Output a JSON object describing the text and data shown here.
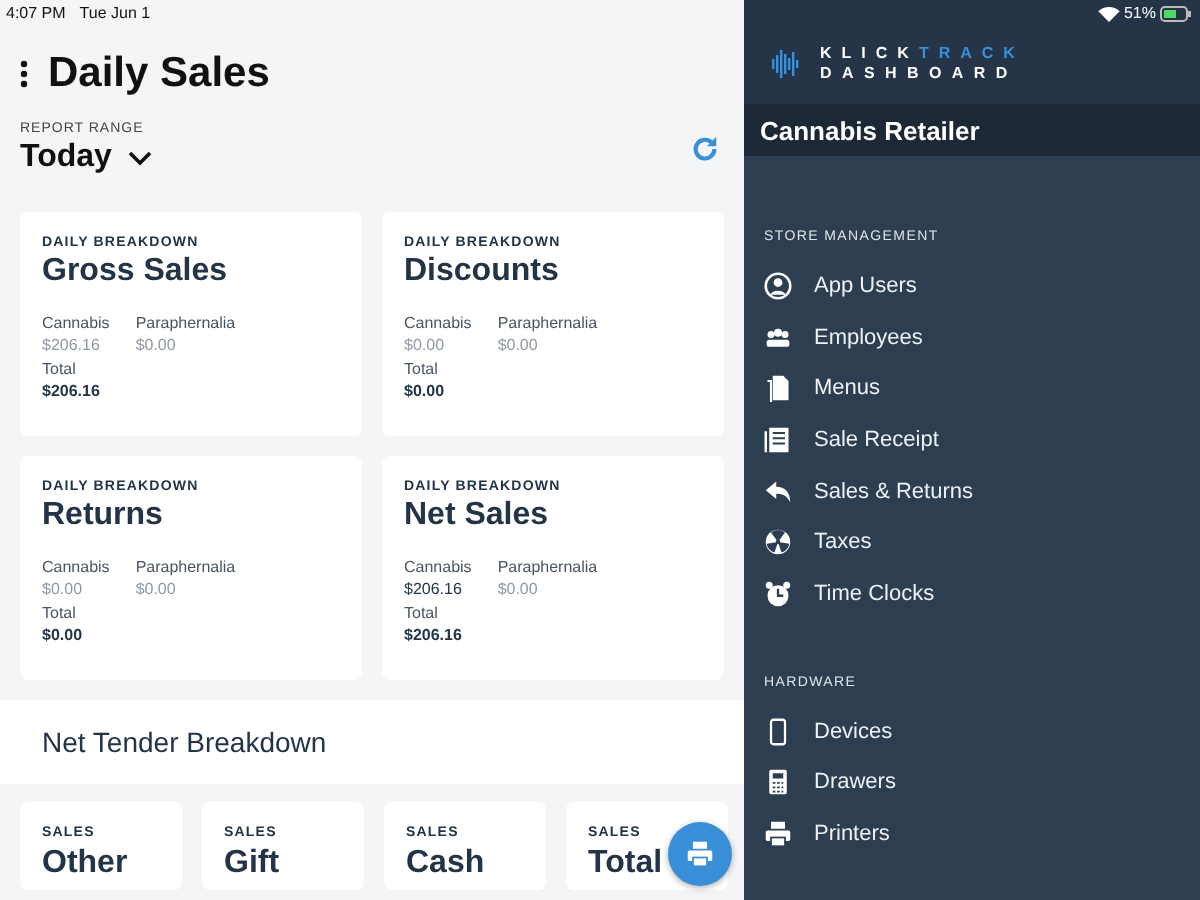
{
  "status_bar": {
    "time": "4:07 PM",
    "date": "Tue Jun 1",
    "battery_text": "51%"
  },
  "header": {
    "title": "Daily Sales",
    "report_range_label": "REPORT RANGE",
    "report_range_value": "Today"
  },
  "breakdown_cards": [
    {
      "overline": "DAILY BREAKDOWN",
      "title": "Gross Sales",
      "values": [
        {
          "label": "Cannabis",
          "amount": "$206.16",
          "dimmed": true
        },
        {
          "label": "Paraphernalia",
          "amount": "$0.00",
          "dimmed": true
        }
      ],
      "total_label": "Total",
      "total": "$206.16"
    },
    {
      "overline": "DAILY BREAKDOWN",
      "title": "Discounts",
      "values": [
        {
          "label": "Cannabis",
          "amount": "$0.00",
          "dimmed": true
        },
        {
          "label": "Paraphernalia",
          "amount": "$0.00",
          "dimmed": true
        }
      ],
      "total_label": "Total",
      "total": "$0.00"
    },
    {
      "overline": "DAILY BREAKDOWN",
      "title": "Returns",
      "values": [
        {
          "label": "Cannabis",
          "amount": "$0.00",
          "dimmed": true
        },
        {
          "label": "Paraphernalia",
          "amount": "$0.00",
          "dimmed": true
        }
      ],
      "total_label": "Total",
      "total": "$0.00"
    },
    {
      "overline": "DAILY BREAKDOWN",
      "title": "Net Sales",
      "values": [
        {
          "label": "Cannabis",
          "amount": "$206.16",
          "dimmed": false
        },
        {
          "label": "Paraphernalia",
          "amount": "$0.00",
          "dimmed": true
        }
      ],
      "total_label": "Total",
      "total": "$206.16"
    }
  ],
  "tender_section": {
    "title": "Net Tender Breakdown"
  },
  "tender_cards": [
    {
      "overline": "SALES",
      "title": "Other"
    },
    {
      "overline": "SALES",
      "title": "Gift"
    },
    {
      "overline": "SALES",
      "title": "Cash"
    },
    {
      "overline": "SALES",
      "title": "Total"
    }
  ],
  "sidebar": {
    "logo": {
      "primary": "KLICK",
      "accent": "TRACK",
      "subtitle": "DASHBOARD"
    },
    "store_name": "Cannabis Retailer",
    "sections": [
      {
        "title": "STORE MANAGEMENT",
        "items": [
          {
            "label": "App Users"
          },
          {
            "label": "Employees"
          },
          {
            "label": "Menus"
          },
          {
            "label": "Sale Receipt"
          },
          {
            "label": "Sales & Returns"
          },
          {
            "label": "Taxes"
          },
          {
            "label": "Time Clocks"
          }
        ]
      },
      {
        "title": "HARDWARE",
        "items": [
          {
            "label": "Devices"
          },
          {
            "label": "Drawers"
          },
          {
            "label": "Printers"
          }
        ]
      }
    ]
  }
}
